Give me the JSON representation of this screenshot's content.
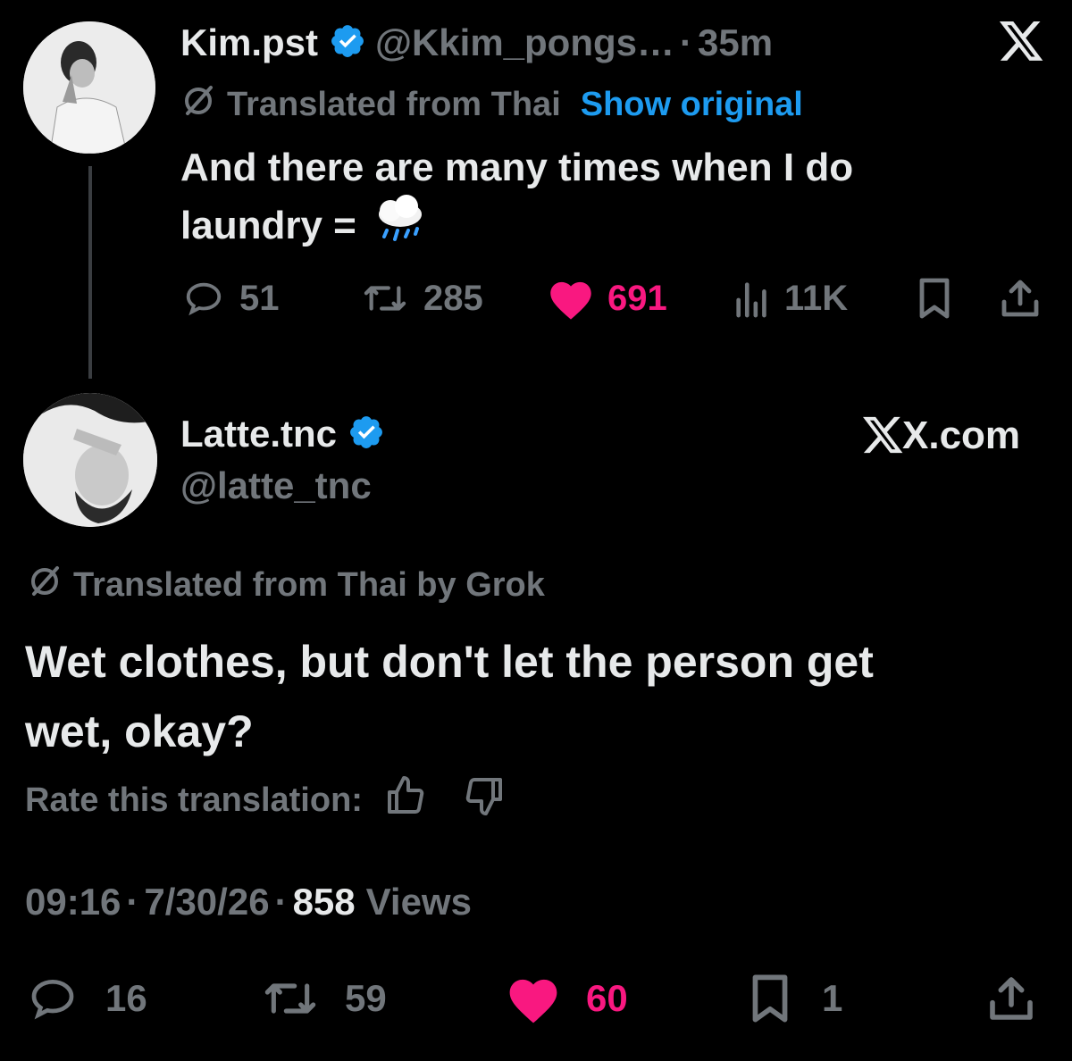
{
  "tweet1": {
    "display_name": "Kim.pst",
    "handle": "@Kkim_pongs…",
    "separator": "·",
    "time": "35m",
    "translated_label": "Translated from Thai",
    "show_original": "Show original",
    "text_line1": "And there are many times when I do",
    "text_line2": "laundry =",
    "emoji": "🌧️",
    "stats": {
      "replies": "51",
      "reposts": "285",
      "likes": "691",
      "views": "11K"
    }
  },
  "tweet2": {
    "display_name": "Latte.tnc",
    "handle": "@latte_tnc",
    "source_label": "X.com",
    "translated_label": "Translated from Thai by Grok",
    "text_line1": "Wet clothes, but don't let the person get",
    "text_line2": "wet, okay?",
    "rate_label": "Rate this translation:",
    "time": "09:16",
    "date": "7/30/26",
    "dot": "·",
    "views_count": "858",
    "views_label": "Views",
    "stats": {
      "replies": "16",
      "reposts": "59",
      "likes": "60",
      "bookmarks": "1"
    }
  },
  "colors": {
    "background": "#000000",
    "text": "#e7e9ea",
    "muted": "#71767b",
    "link": "#1d9bf0",
    "like": "#f91880",
    "verified": "#1d9bf0"
  }
}
